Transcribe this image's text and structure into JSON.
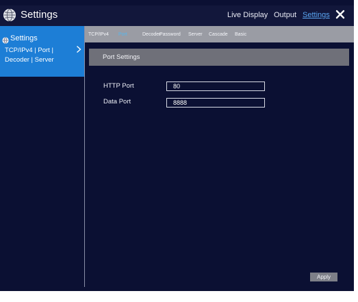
{
  "header": {
    "title": "Settings",
    "icon": "settings-globe-icon",
    "nav": [
      "Live Display",
      "Output",
      "Settings"
    ],
    "active_nav": "Settings",
    "close_icon": "close-icon"
  },
  "sidebar": {
    "heading": "Settings",
    "heading_icon": "gear-icon",
    "sub_line1": "TCP/IPv4 | Port |",
    "sub_line2": "Decoder | Server",
    "chevron_icon": "chevron-right-icon"
  },
  "tabs": [
    {
      "label": "TCP/IPv4",
      "active": false
    },
    {
      "label": "Port",
      "active": true
    },
    {
      "label": "Decoder",
      "active": false
    },
    {
      "label": "Password",
      "active": false
    },
    {
      "label": "Server",
      "active": false
    },
    {
      "label": "Cascade",
      "active": false
    },
    {
      "label": "Basic",
      "active": false
    }
  ],
  "section": {
    "title": "Port Settings"
  },
  "fields": [
    {
      "label": "HTTP Port",
      "value": "80"
    },
    {
      "label": "Data Port",
      "value": "8888"
    }
  ],
  "apply_label": "Apply",
  "colors": {
    "background": "#0b1033",
    "sidebar_active": "#1d7ed6",
    "tabstrip": "#9a9ca4",
    "section_header": "#6f7079",
    "accent": "#5aa6f2",
    "active_tab": "#54b8f0"
  }
}
